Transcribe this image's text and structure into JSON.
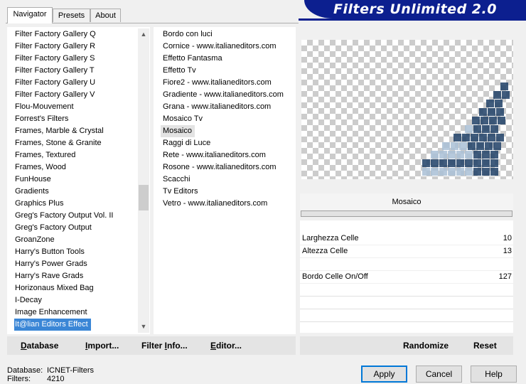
{
  "tabs": [
    {
      "label": "Navigator"
    },
    {
      "label": "Presets"
    },
    {
      "label": "About"
    }
  ],
  "brand": {
    "title": "Filters Unlimited 2.0",
    "color": "#0c1f8f"
  },
  "categories": {
    "items": [
      "Filter Factory Gallery Q",
      "Filter Factory Gallery R",
      "Filter Factory Gallery S",
      "Filter Factory Gallery T",
      "Filter Factory Gallery U",
      "Filter Factory Gallery V",
      "Flou-Mouvement",
      "Forrest's Filters",
      "Frames, Marble & Crystal",
      "Frames, Stone & Granite",
      "Frames, Textured",
      "Frames, Wood",
      "FunHouse",
      "Gradients",
      "Graphics Plus",
      "Greg's Factory Output Vol. II",
      "Greg's Factory Output",
      "GroanZone",
      "Harry's Button Tools",
      "Harry's Power Grads",
      "Harry's Rave Grads",
      "Horizonaus Mixed Bag",
      "I-Decay",
      "Image Enhancement",
      "It@lian Editors Effect"
    ],
    "selected": "It@lian Editors Effect"
  },
  "filters": {
    "items": [
      "Bordo con luci",
      "Cornice - www.italianeditors.com",
      "Effetto Fantasma",
      "Effetto Tv",
      "Fiore2 - www.italianeditors.com",
      "Gradiente - www.italianeditors.com",
      "Grana - www.italianeditors.com",
      "Mosaico Tv",
      "Mosaico",
      "Raggi di Luce",
      "Rete - www.italianeditors.com",
      "Rosone - www.italianeditors.com",
      "Scacchi",
      "Tv Editors",
      "Vetro - www.italianeditors.com"
    ],
    "selected": "Mosaico"
  },
  "selected_filter_title": "Mosaico",
  "parameters": [
    {
      "label": "Larghezza Celle",
      "value": "10"
    },
    {
      "label": "Altezza Celle",
      "value": "13"
    },
    {
      "label": "Bordo Celle On/Off",
      "value": "127"
    }
  ],
  "left_bar": {
    "database": {
      "underline": "D",
      "rest": "atabase"
    },
    "import": {
      "underline": "I",
      "rest": "mport..."
    },
    "filter_info": {
      "prefix": "Filter ",
      "underline": "I",
      "rest": "nfo..."
    },
    "editor": {
      "underline": "E",
      "rest": "ditor..."
    }
  },
  "right_bar": {
    "randomize": "Randomize",
    "reset": "Reset"
  },
  "status": {
    "database_label": "Database:",
    "database_value": "ICNET-Filters",
    "filters_label": "Filters:",
    "filters_value": "4210"
  },
  "dialog": {
    "apply": "Apply",
    "cancel": "Cancel",
    "help": "Help"
  },
  "colors": {
    "selection": "#3a86d6",
    "focus_border": "#0078d7",
    "preview_tile_dark": "#1f3f66",
    "preview_tile_light": "#a9bfd6"
  }
}
